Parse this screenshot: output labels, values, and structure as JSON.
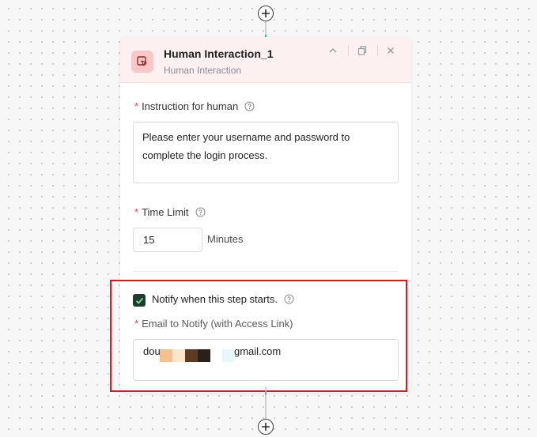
{
  "node": {
    "title": "Human Interaction_1",
    "subtitle": "Human Interaction"
  },
  "instruction": {
    "required_mark": "*",
    "label": "Instruction for human",
    "value": "Please enter your username and password to complete the login process."
  },
  "time_limit": {
    "required_mark": "*",
    "label": "Time Limit",
    "value": "15",
    "unit": "Minutes"
  },
  "notify": {
    "checked": true,
    "label": "Notify when this step starts."
  },
  "email": {
    "required_mark": "*",
    "label": "Email to Notify (with Access Link)",
    "value_prefix": "dou",
    "value_suffix": "gmail.com"
  },
  "colors": {
    "accent_green": "#1f3d2e",
    "required_red": "#e5484d",
    "highlight_red": "#e0161d",
    "header_bg": "#fdf0f0"
  },
  "icons": {
    "add": "plus-icon",
    "node": "human-interaction-icon",
    "collapse": "chevron-up-icon",
    "copy": "copy-icon",
    "close": "close-icon",
    "help": "help-circle-icon",
    "check": "check-icon"
  }
}
